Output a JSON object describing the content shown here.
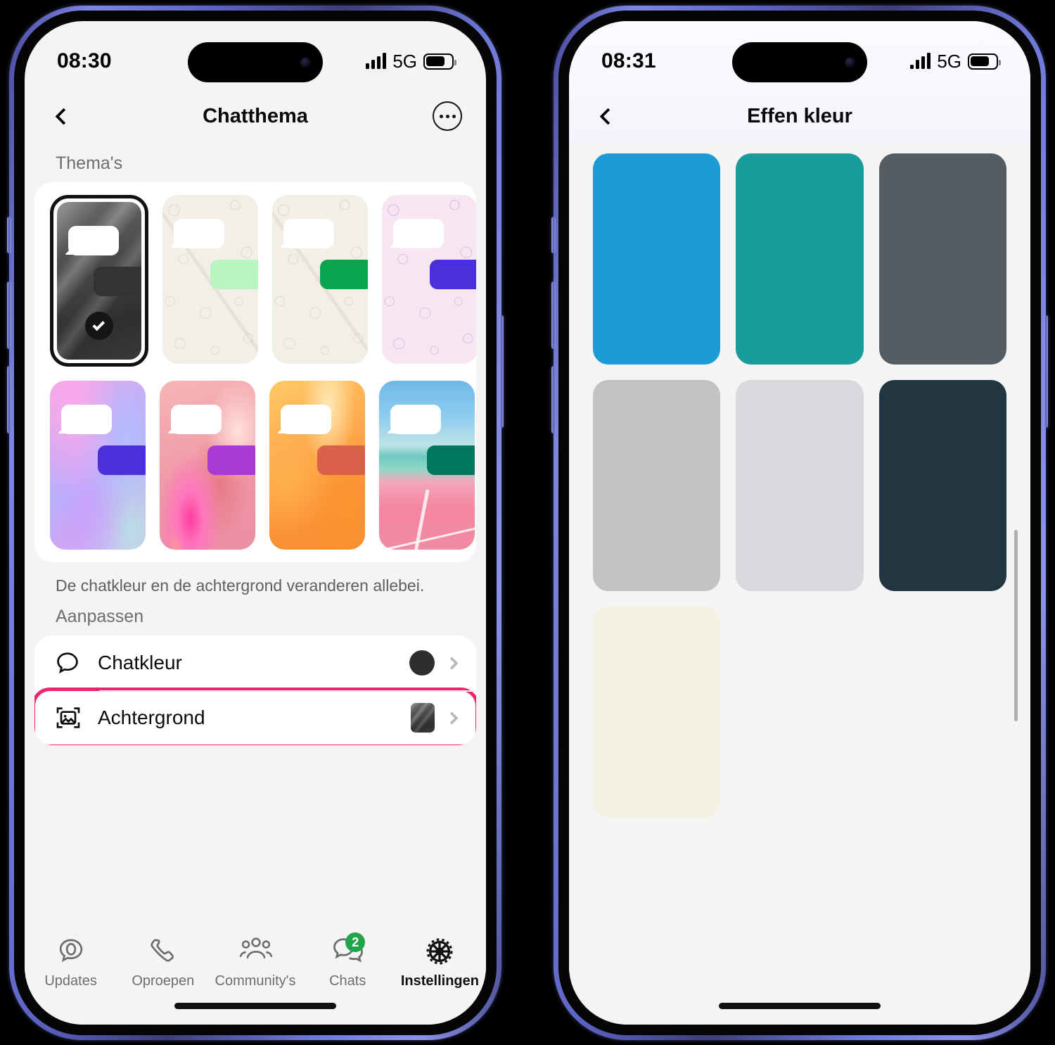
{
  "meta": {
    "accent_highlight": "#f0256f",
    "badge_green": "#22a44c",
    "frame_color": "#6f78d8"
  },
  "phone_left": {
    "status_bar": {
      "time": "08:30",
      "network": "5G",
      "signal_icon": "cellular-bars-icon",
      "battery_icon": "battery-icon"
    },
    "nav": {
      "back_icon": "chevron-left-icon",
      "title": "Chatthema",
      "more_icon": "ellipsis-icon"
    },
    "sections": {
      "themes_label": "Thema's",
      "caption": "De chatkleur en de achtergrond veranderen allebei.",
      "customize_label": "Aanpassen"
    },
    "themes": [
      {
        "name": "dark-sand-theme",
        "selected": true,
        "bubble_out": "#333333",
        "style": "bg-dark"
      },
      {
        "name": "doodle-green-theme",
        "selected": false,
        "bubble_out": "#b8f5c0",
        "style": "doodle"
      },
      {
        "name": "doodle-default-theme",
        "selected": false,
        "bubble_out": "#09a44d",
        "style": "doodle"
      },
      {
        "name": "doodle-purple-theme",
        "selected": false,
        "bubble_out": "#4b2fdb",
        "style": "doodle-pink"
      },
      {
        "name": "holographic-theme",
        "selected": false,
        "bubble_out": "#4b2fdb",
        "style": "bg-holo"
      },
      {
        "name": "flower-pink-theme",
        "selected": false,
        "bubble_out": "#a93bd4",
        "style": "bg-flower"
      },
      {
        "name": "orange-silk-theme",
        "selected": false,
        "bubble_out": "#d9614a",
        "style": "bg-orange"
      },
      {
        "name": "beach-theme",
        "selected": false,
        "bubble_out": "#00775d",
        "style": "bg-beach"
      }
    ],
    "rows": [
      {
        "icon": "chat-bubble-icon",
        "label": "Chatkleur",
        "value_type": "color-dot",
        "value": "#2e2e2e",
        "chevron": "chevron-right-icon",
        "highlighted": false
      },
      {
        "icon": "image-icon",
        "label": "Achtergrond",
        "value_type": "thumbnail",
        "value": "dark-sand-thumbnail",
        "chevron": "chevron-right-icon",
        "highlighted": true
      }
    ],
    "tabs": [
      {
        "label": "Updates",
        "icon": "updates-icon",
        "active": false,
        "badge": null
      },
      {
        "label": "Oproepen",
        "icon": "phone-icon",
        "active": false,
        "badge": null
      },
      {
        "label": "Community's",
        "icon": "communities-icon",
        "active": false,
        "badge": null
      },
      {
        "label": "Chats",
        "icon": "chats-icon",
        "active": false,
        "badge": "2"
      },
      {
        "label": "Instellingen",
        "icon": "settings-gear-icon",
        "active": true,
        "badge": null
      }
    ]
  },
  "phone_right": {
    "status_bar": {
      "time": "08:31",
      "network": "5G",
      "signal_icon": "cellular-bars-icon",
      "battery_icon": "battery-icon"
    },
    "nav": {
      "back_icon": "chevron-left-icon",
      "title": "Effen kleur"
    },
    "colors_top_partial": [
      "#8592a3",
      "#7e6fe0",
      "#2c52a6"
    ],
    "colors": [
      {
        "name": "swatch-sky-blue",
        "hex": "#1d9bd6"
      },
      {
        "name": "swatch-teal",
        "hex": "#1a9c9c"
      },
      {
        "name": "swatch-slate-gray",
        "hex": "#555d63"
      },
      {
        "name": "swatch-light-gray",
        "hex": "#c2c2c4"
      },
      {
        "name": "swatch-pale-gray",
        "hex": "#d8d9dd"
      },
      {
        "name": "swatch-dark-navy",
        "hex": "#213641"
      },
      {
        "name": "swatch-cream",
        "hex": "#f3f0e4"
      }
    ],
    "scrollbar": "vertical-scrollbar"
  }
}
